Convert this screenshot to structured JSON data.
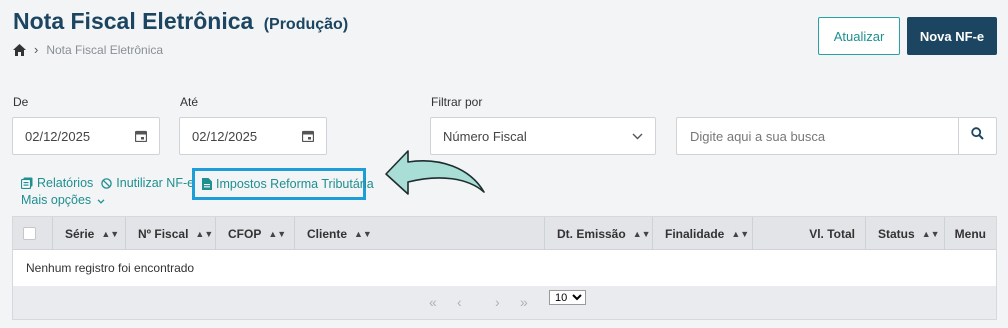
{
  "header": {
    "title": "Nota Fiscal Eletrônica",
    "environment": "(Produção)",
    "breadcrumb": [
      "Nota Fiscal Eletrônica"
    ],
    "refresh_label": "Atualizar",
    "new_label": "Nova NF-e"
  },
  "filters": {
    "from_label": "De",
    "from_value": "02/12/2025",
    "to_label": "Até",
    "to_value": "02/12/2025",
    "filter_by_label": "Filtrar por",
    "filter_by_value": "Número Fiscal",
    "search_placeholder": "Digite aqui a sua busca"
  },
  "actions": {
    "reports": "Relatórios",
    "void": "Inutilizar NF-e",
    "taxes": "Impostos Reforma Tributária",
    "more": "Mais opções"
  },
  "table": {
    "columns": [
      "Série",
      "Nº Fiscal",
      "CFOP",
      "Cliente",
      "Dt. Emissão",
      "Finalidade",
      "Vl. Total",
      "Status",
      "Menu"
    ],
    "empty_message": "Nenhum registro foi encontrado",
    "page_size": "10",
    "page_size_options": [
      "10"
    ]
  },
  "colors": {
    "primary": "#1b4560",
    "accent": "#1f8f8f",
    "highlight": "#1e9ed8",
    "arrow_fill": "#a8ded5"
  }
}
